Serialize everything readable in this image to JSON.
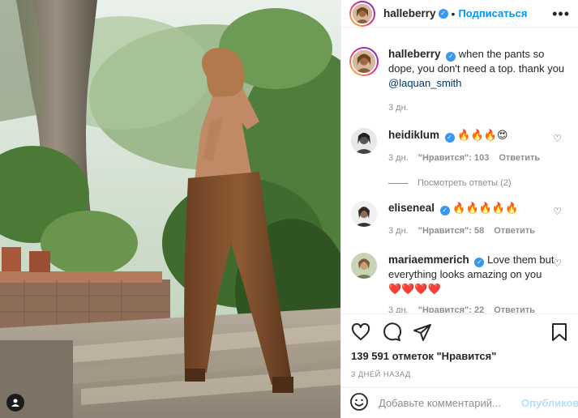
{
  "header": {
    "username": "halleberry",
    "separator": "•",
    "follow_label": "Подписаться",
    "more_label": "•••"
  },
  "caption": {
    "username": "halleberry",
    "text": "when the pants so dope, you don't need a top. thank you",
    "mention": "@laquan_smith",
    "time": "3 дн."
  },
  "comments": [
    {
      "username": "heidiklum",
      "text": "🔥🔥🔥😍",
      "time": "3 дн.",
      "likes": "\"Нравится\": 103",
      "reply_label": "Ответить",
      "view_replies": "Посмотреть ответы (2)"
    },
    {
      "username": "eliseneal",
      "text": "🔥🔥🔥🔥🔥",
      "time": "3 дн.",
      "likes": "\"Нравится\": 58",
      "reply_label": "Ответить"
    },
    {
      "username": "mariaemmerich",
      "text": "Love them but everything looks amazing on you",
      "hearts": "❤️❤️❤️❤️",
      "time": "3 дн.",
      "likes": "\"Нравится\": 22",
      "reply_label": "Ответить"
    }
  ],
  "actions": {
    "likes_count": "139 591 отметок \"Нравится\"",
    "date": "3 ДНЕЙ НАЗАД",
    "icons": [
      "heart-icon",
      "comment-icon",
      "share-icon",
      "bookmark-icon"
    ]
  },
  "add_comment": {
    "placeholder": "Добавьте комментарий...",
    "publish_label": "Опубликовать"
  },
  "colors": {
    "link_blue": "#0095f6",
    "verified_blue": "#3897f0",
    "muted": "#8e8e8e",
    "publish_disabled": "#b2dffc"
  }
}
